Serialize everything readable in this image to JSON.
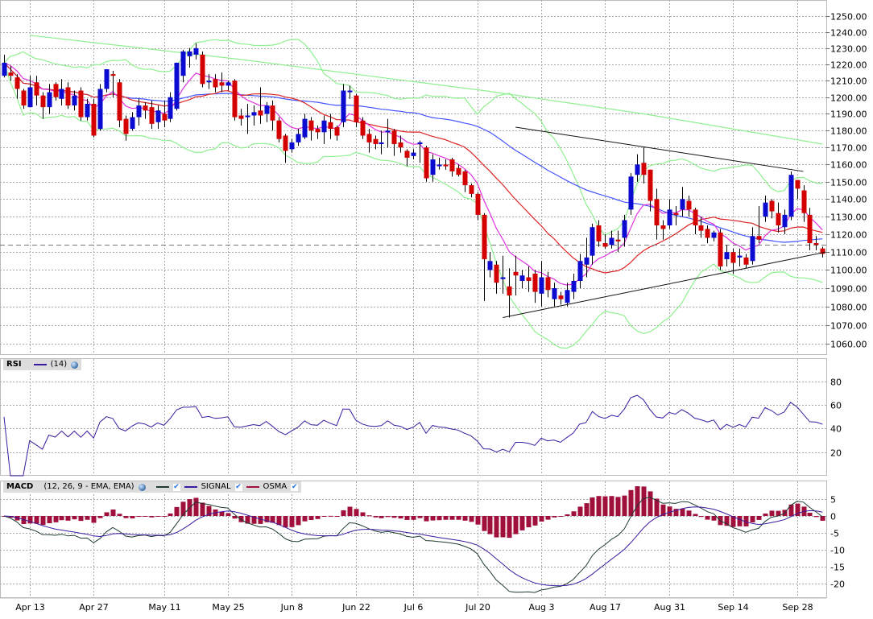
{
  "chart_data": {
    "type": "candlestick",
    "price_scale": "log",
    "ylim": [
      1055,
      1255
    ],
    "y_ticks": [
      "1250.00",
      "1240.00",
      "1230.00",
      "1220.00",
      "1210.00",
      "1200.00",
      "1190.00",
      "1180.00",
      "1170.00",
      "1160.00",
      "1150.00",
      "1140.00",
      "1130.00",
      "1120.00",
      "1110.00",
      "1100.00",
      "1090.00",
      "1080.00",
      "1070.00",
      "1060.00"
    ],
    "x_ticks": [
      {
        "label": "Apr 13",
        "idx": 4
      },
      {
        "label": "Apr 27",
        "idx": 14
      },
      {
        "label": "May 11",
        "idx": 25
      },
      {
        "label": "May 25",
        "idx": 35
      },
      {
        "label": "Jun 8",
        "idx": 45
      },
      {
        "label": "Jun 22",
        "idx": 55
      },
      {
        "label": "Jul 6",
        "idx": 64
      },
      {
        "label": "Jul 20",
        "idx": 74
      },
      {
        "label": "Aug 3",
        "idx": 84
      },
      {
        "label": "Aug 17",
        "idx": 94
      },
      {
        "label": "Aug 31",
        "idx": 104
      },
      {
        "label": "Sep 14",
        "idx": 114
      },
      {
        "label": "Sep 28",
        "idx": 124
      }
    ],
    "candles_ohlc": [
      [
        1213,
        1226,
        1212,
        1221
      ],
      [
        1215,
        1219,
        1210,
        1213
      ],
      [
        1212,
        1214,
        1199,
        1205
      ],
      [
        1204,
        1205,
        1193,
        1195
      ],
      [
        1194,
        1213,
        1194,
        1206
      ],
      [
        1209,
        1213,
        1195,
        1201
      ],
      [
        1201,
        1203,
        1187,
        1194
      ],
      [
        1194,
        1208,
        1190,
        1203
      ],
      [
        1208,
        1209,
        1198,
        1200
      ],
      [
        1199,
        1211,
        1195,
        1205
      ],
      [
        1206,
        1209,
        1193,
        1195
      ],
      [
        1195,
        1204,
        1192,
        1201
      ],
      [
        1204,
        1206,
        1186,
        1188
      ],
      [
        1188,
        1199,
        1186,
        1196
      ],
      [
        1196,
        1199,
        1176,
        1177
      ],
      [
        1181,
        1208,
        1180,
        1205
      ],
      [
        1205,
        1217,
        1203,
        1217
      ],
      [
        1214,
        1216,
        1200,
        1213
      ],
      [
        1209,
        1211,
        1182,
        1186
      ],
      [
        1187,
        1189,
        1174,
        1178
      ],
      [
        1181,
        1191,
        1180,
        1188
      ],
      [
        1188,
        1199,
        1183,
        1195
      ],
      [
        1195,
        1197,
        1187,
        1192
      ],
      [
        1194,
        1198,
        1181,
        1184
      ],
      [
        1185,
        1195,
        1181,
        1192
      ],
      [
        1190,
        1198,
        1182,
        1186
      ],
      [
        1187,
        1203,
        1185,
        1200
      ],
      [
        1193,
        1221,
        1192,
        1221
      ],
      [
        1213,
        1229,
        1209,
        1228
      ],
      [
        1225,
        1230,
        1218,
        1228
      ],
      [
        1226,
        1233,
        1223,
        1230
      ],
      [
        1226,
        1228,
        1206,
        1208
      ],
      [
        1209,
        1214,
        1205,
        1210
      ],
      [
        1211,
        1214,
        1203,
        1206
      ],
      [
        1209,
        1215,
        1203,
        1207
      ],
      [
        1207,
        1210,
        1204,
        1209
      ],
      [
        1210,
        1211,
        1186,
        1188
      ],
      [
        1189,
        1193,
        1183,
        1187
      ],
      [
        1188,
        1196,
        1178,
        1189
      ],
      [
        1189,
        1195,
        1183,
        1191
      ],
      [
        1192,
        1206,
        1184,
        1189
      ],
      [
        1190,
        1197,
        1185,
        1195
      ],
      [
        1195,
        1198,
        1180,
        1186
      ],
      [
        1186,
        1188,
        1173,
        1175
      ],
      [
        1177,
        1178,
        1161,
        1168
      ],
      [
        1169,
        1175,
        1167,
        1173
      ],
      [
        1173,
        1181,
        1171,
        1178
      ],
      [
        1176,
        1190,
        1175,
        1187
      ],
      [
        1186,
        1188,
        1174,
        1180
      ],
      [
        1181,
        1183,
        1175,
        1179
      ],
      [
        1179,
        1189,
        1172,
        1186
      ],
      [
        1185,
        1190,
        1175,
        1181
      ],
      [
        1182,
        1183,
        1174,
        1177
      ],
      [
        1185,
        1208,
        1182,
        1204
      ],
      [
        1203,
        1207,
        1199,
        1204
      ],
      [
        1201,
        1202,
        1182,
        1185
      ],
      [
        1186,
        1188,
        1175,
        1177
      ],
      [
        1178,
        1181,
        1167,
        1173
      ],
      [
        1175,
        1177,
        1169,
        1172
      ],
      [
        1172,
        1180,
        1166,
        1173
      ],
      [
        1179,
        1187,
        1170,
        1180
      ],
      [
        1180,
        1181,
        1165,
        1172
      ],
      [
        1173,
        1177,
        1167,
        1170
      ],
      [
        1168,
        1169,
        1159,
        1164
      ],
      [
        1165,
        1169,
        1163,
        1167
      ],
      [
        1172,
        1174,
        1161,
        1173
      ],
      [
        1170,
        1171,
        1150,
        1152
      ],
      [
        1154,
        1166,
        1150,
        1163
      ],
      [
        1159,
        1164,
        1157,
        1160
      ],
      [
        1160,
        1163,
        1157,
        1159
      ],
      [
        1163,
        1164,
        1153,
        1156
      ],
      [
        1158,
        1160,
        1153,
        1154
      ],
      [
        1156,
        1157,
        1144,
        1148
      ],
      [
        1148,
        1149,
        1141,
        1143
      ],
      [
        1143,
        1144,
        1128,
        1131
      ],
      [
        1131,
        1132,
        1083,
        1106
      ],
      [
        1100,
        1110,
        1096,
        1105
      ],
      [
        1103,
        1105,
        1087,
        1093
      ],
      [
        1095,
        1108,
        1087,
        1096
      ],
      [
        1091,
        1101,
        1074,
        1086
      ],
      [
        1099,
        1108,
        1086,
        1097
      ],
      [
        1094,
        1100,
        1090,
        1097
      ],
      [
        1096,
        1102,
        1088,
        1094
      ],
      [
        1098,
        1100,
        1082,
        1088
      ],
      [
        1087,
        1105,
        1080,
        1096
      ],
      [
        1096,
        1099,
        1085,
        1089
      ],
      [
        1084,
        1093,
        1080,
        1090
      ],
      [
        1086,
        1088,
        1081,
        1084
      ],
      [
        1082,
        1093,
        1080,
        1089
      ],
      [
        1088,
        1098,
        1084,
        1094
      ],
      [
        1094,
        1109,
        1090,
        1105
      ],
      [
        1103,
        1118,
        1096,
        1107
      ],
      [
        1108,
        1126,
        1103,
        1124
      ],
      [
        1125,
        1128,
        1113,
        1116
      ],
      [
        1115,
        1120,
        1112,
        1113
      ],
      [
        1114,
        1122,
        1112,
        1118
      ],
      [
        1117,
        1122,
        1110,
        1116
      ],
      [
        1118,
        1131,
        1113,
        1128
      ],
      [
        1134,
        1155,
        1131,
        1153
      ],
      [
        1154,
        1166,
        1150,
        1160
      ],
      [
        1161,
        1170,
        1149,
        1154
      ],
      [
        1157,
        1157,
        1133,
        1139
      ],
      [
        1140,
        1146,
        1117,
        1125
      ],
      [
        1125,
        1128,
        1117,
        1123
      ],
      [
        1125,
        1140,
        1123,
        1134
      ],
      [
        1132,
        1136,
        1125,
        1131
      ],
      [
        1134,
        1147,
        1130,
        1140
      ],
      [
        1139,
        1142,
        1130,
        1134
      ],
      [
        1134,
        1135,
        1120,
        1125
      ],
      [
        1125,
        1130,
        1118,
        1122
      ],
      [
        1123,
        1125,
        1115,
        1118
      ],
      [
        1118,
        1122,
        1116,
        1121
      ],
      [
        1121,
        1123,
        1100,
        1102
      ],
      [
        1106,
        1114,
        1102,
        1110
      ],
      [
        1110,
        1112,
        1098,
        1104
      ],
      [
        1107,
        1112,
        1102,
        1108
      ],
      [
        1107,
        1109,
        1101,
        1103
      ],
      [
        1105,
        1124,
        1103,
        1119
      ],
      [
        1119,
        1136,
        1115,
        1117
      ],
      [
        1130,
        1142,
        1127,
        1138
      ],
      [
        1139,
        1140,
        1129,
        1133
      ],
      [
        1132,
        1138,
        1121,
        1125
      ],
      [
        1124,
        1134,
        1120,
        1131
      ],
      [
        1130,
        1156,
        1128,
        1154
      ],
      [
        1151,
        1151,
        1140,
        1146
      ],
      [
        1145,
        1148,
        1127,
        1132
      ],
      [
        1131,
        1135,
        1111,
        1115
      ],
      [
        1115,
        1119,
        1111,
        1114
      ],
      [
        1112,
        1113,
        1107,
        1109
      ]
    ],
    "long_ma_keypoints": [
      [
        4,
        1238
      ],
      [
        37,
        1223
      ],
      [
        75,
        1204
      ],
      [
        100,
        1190
      ],
      [
        128,
        1172
      ]
    ],
    "trendlines": [
      {
        "from": [
          80,
          1182
        ],
        "to": [
          125,
          1156
        ]
      },
      {
        "from": [
          78,
          1074
        ],
        "to": [
          128.5,
          1110
        ]
      }
    ],
    "price_line": 1114,
    "colors": {
      "up": "#0a0ad0",
      "down": "#d40000",
      "ma_fast": "#e030e0",
      "ma_mid": "#dd2222",
      "ma_slow": "#4455ff",
      "bands": "#8ef08e",
      "rsi": "#3a1aa0",
      "macd": "#1e3a32",
      "signal": "#3a1aa0",
      "osma": "#a0103a"
    },
    "rsi": {
      "title": "RSI",
      "period_label": "(14)",
      "period": 14,
      "ylim": [
        0,
        100
      ],
      "ticks": [
        "80",
        "60",
        "40",
        "20"
      ]
    },
    "macd": {
      "title": "MACD",
      "params_label": "(12, 26, 9 - EMA, EMA)",
      "fast": 12,
      "slow": 26,
      "signal_period": 9,
      "signal_label": "SIGNAL",
      "osma_label": "OSMA",
      "ticks": [
        "5",
        "0",
        "-5",
        "-10",
        "-15",
        "-20"
      ]
    }
  }
}
